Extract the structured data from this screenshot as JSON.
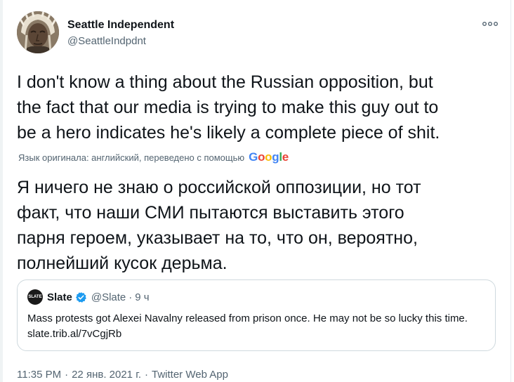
{
  "author": {
    "display_name": "Seattle Independent",
    "handle": "@SeattleIndpdnt",
    "avatar_icon": "avatar-native-headdress-portrait"
  },
  "tweet": {
    "text": "I don't know a thing about the Russian opposition, but\nthe fact that our media is trying to make this guy out to\nbe a hero indicates he's likely a complete piece of shit.",
    "translation_note": "Язык оригинала: английский, переведено с помощью",
    "translation_provider": "Google",
    "translated_text": "Я ничего не знаю о российской оппозиции, но тот\nфакт, что наши СМИ пытаются выставить этого\nпарня героем, указывает на то, что он, вероятно,\nполнейший кусок дерьма."
  },
  "quote": {
    "logo_text": "SLATE",
    "name": "Slate",
    "handle": "@Slate",
    "separator": "·",
    "time": "9 ч",
    "text": "Mass protests got Alexei Navalny released from prison once. He may not be so lucky this time.",
    "link": "slate.trib.al/7vCgjRb"
  },
  "footer": {
    "time": "11:35 PM",
    "date": "22 янв. 2021 г.",
    "source": "Twitter Web App",
    "separator": "·"
  },
  "colors": {
    "text_primary": "#0f1419",
    "text_secondary": "#536471",
    "verified_blue": "#1d9bf0",
    "border": "#cfd9de"
  }
}
